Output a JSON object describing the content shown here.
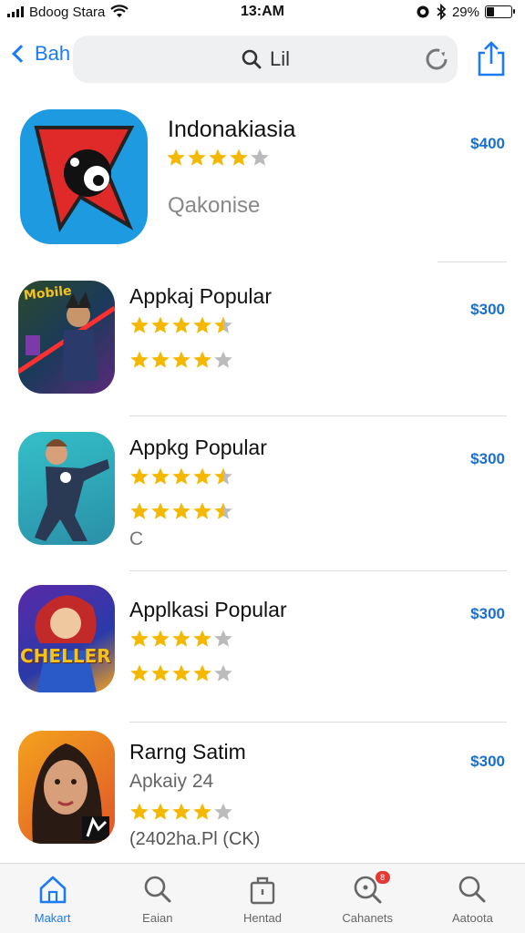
{
  "status_bar": {
    "carrier": "Bdoog Stara",
    "time": "13:AM",
    "battery": "29%",
    "battery_level": 0.29
  },
  "nav": {
    "back_label": "Bah",
    "search_text": "Lil"
  },
  "apps": [
    {
      "name": "Indonakiasia",
      "price": "$400",
      "rating": 4,
      "subtitle": "Qakonise",
      "icon": "flag-character-icon",
      "colors": {
        "bg": "#1e9be0",
        "accent": "#e02a2a"
      }
    },
    {
      "name": "Appkaj Popular",
      "price": "$300",
      "rating": 4.5,
      "rating2": 4,
      "icon": "game-warrior-icon",
      "icon_text": "Mobile",
      "colors": {
        "bg": "#1b3a5a",
        "accent": "#f3c21d"
      }
    },
    {
      "name": "Appkg Popular",
      "price": "$300",
      "rating": 4.5,
      "rating2": 4.5,
      "subtitle": "C",
      "icon": "hero-flying-icon",
      "colors": {
        "bg": "#2aa8b8",
        "accent": "#2a3a55"
      }
    },
    {
      "name": "Applkasi Popular",
      "price": "$300",
      "rating": 4,
      "rating2": 4,
      "icon": "heroine-icon",
      "icon_text": "CHELLER",
      "colors": {
        "bg": "#3a3aa8",
        "accent": "#f3b21d"
      }
    },
    {
      "name": "Rarng Satim",
      "price": "$300",
      "publisher": "Apkaiy 24",
      "rating": 4,
      "reviews": "(2402ha.Pl (CK)",
      "icon": "woman-portrait-icon",
      "colors": {
        "bg": "#e0552a",
        "accent": "#2a2a2a"
      }
    }
  ],
  "tabs": [
    {
      "label": "Makart",
      "icon": "home-icon",
      "active": true
    },
    {
      "label": "Eaian",
      "icon": "search-icon",
      "active": false
    },
    {
      "label": "Hentad",
      "icon": "bag-icon",
      "active": false
    },
    {
      "label": "Cahanets",
      "icon": "search-badge-icon",
      "active": false,
      "badge": "8"
    },
    {
      "label": "Aatoota",
      "icon": "search-icon",
      "active": false
    }
  ],
  "colors": {
    "accent": "#1a7cf0",
    "price": "#1a6fd0",
    "star": "#f5b800",
    "star_empty": "#bbbbbb"
  }
}
